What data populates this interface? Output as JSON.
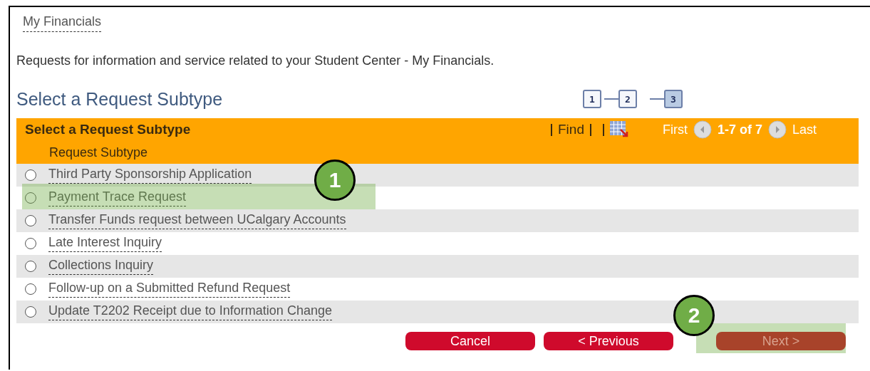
{
  "breadcrumb": "My Financials",
  "description": "Requests for information and service related to your Student Center - My Financials.",
  "heading": "Select a Request Subtype",
  "steps": [
    {
      "label": "1",
      "selected": false
    },
    {
      "label": "2",
      "selected": false
    },
    {
      "label": "3",
      "selected": true
    }
  ],
  "grid": {
    "title": "Select a Request Subtype",
    "find": "Find",
    "first": "First",
    "range": "1-7 of 7",
    "last": "Last",
    "column": "Request Subtype",
    "rows": [
      {
        "label": "Third Party Sponsorship Application",
        "selected": false
      },
      {
        "label": "Payment Trace Request",
        "selected": false,
        "marker": "1"
      },
      {
        "label": "Transfer Funds request between UCalgary Accounts",
        "selected": false
      },
      {
        "label": "Late Interest Inquiry",
        "selected": false
      },
      {
        "label": "Collections Inquiry",
        "selected": false
      },
      {
        "label": "Follow-up on a Submitted Refund Request",
        "selected": false
      },
      {
        "label": "Update T2202 Receipt due to Information Change",
        "selected": false
      }
    ]
  },
  "buttons": [
    {
      "label": "Cancel",
      "kind": "cancel"
    },
    {
      "label": "< Previous",
      "kind": "previous"
    },
    {
      "label": "Next >",
      "kind": "next",
      "marker": "2"
    }
  ]
}
